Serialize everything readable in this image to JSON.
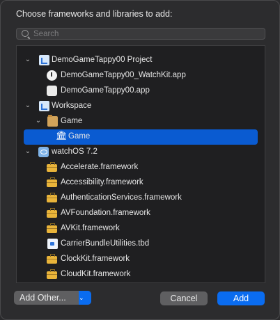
{
  "dialog": {
    "title": "Choose frameworks and libraries to add:"
  },
  "search": {
    "placeholder": "Search",
    "value": ""
  },
  "tree": [
    {
      "label": "DemoGameTappy00 Project",
      "icon": "project-doc-icon",
      "disclosure": "expanded"
    },
    {
      "label": "DemoGameTappy00_WatchKit.app",
      "icon": "watch-app-icon"
    },
    {
      "label": "DemoGameTappy00.app",
      "icon": "app-icon"
    },
    {
      "label": "Workspace",
      "icon": "workspace-doc-icon",
      "disclosure": "expanded"
    },
    {
      "label": "Game",
      "icon": "folder-icon",
      "disclosure": "expanded"
    },
    {
      "label": "Game",
      "icon": "library-icon",
      "selected": true
    },
    {
      "label": "watchOS 7.2",
      "icon": "sdk-icon",
      "disclosure": "expanded"
    },
    {
      "label": "Accelerate.framework",
      "icon": "framework-toolbox-icon"
    },
    {
      "label": "Accessibility.framework",
      "icon": "framework-toolbox-icon"
    },
    {
      "label": "AuthenticationServices.framework",
      "icon": "framework-toolbox-icon"
    },
    {
      "label": "AVFoundation.framework",
      "icon": "framework-toolbox-icon"
    },
    {
      "label": "AVKit.framework",
      "icon": "framework-toolbox-icon"
    },
    {
      "label": "CarrierBundleUtilities.tbd",
      "icon": "tbd-file-icon"
    },
    {
      "label": "ClockKit.framework",
      "icon": "framework-toolbox-icon"
    },
    {
      "label": "CloudKit.framework",
      "icon": "framework-toolbox-icon"
    }
  ],
  "buttons": {
    "add_other": "Add Other...",
    "cancel": "Cancel",
    "add": "Add"
  },
  "colors": {
    "accent": "#0a5bd1",
    "button_blue": "#0a6cf0"
  }
}
